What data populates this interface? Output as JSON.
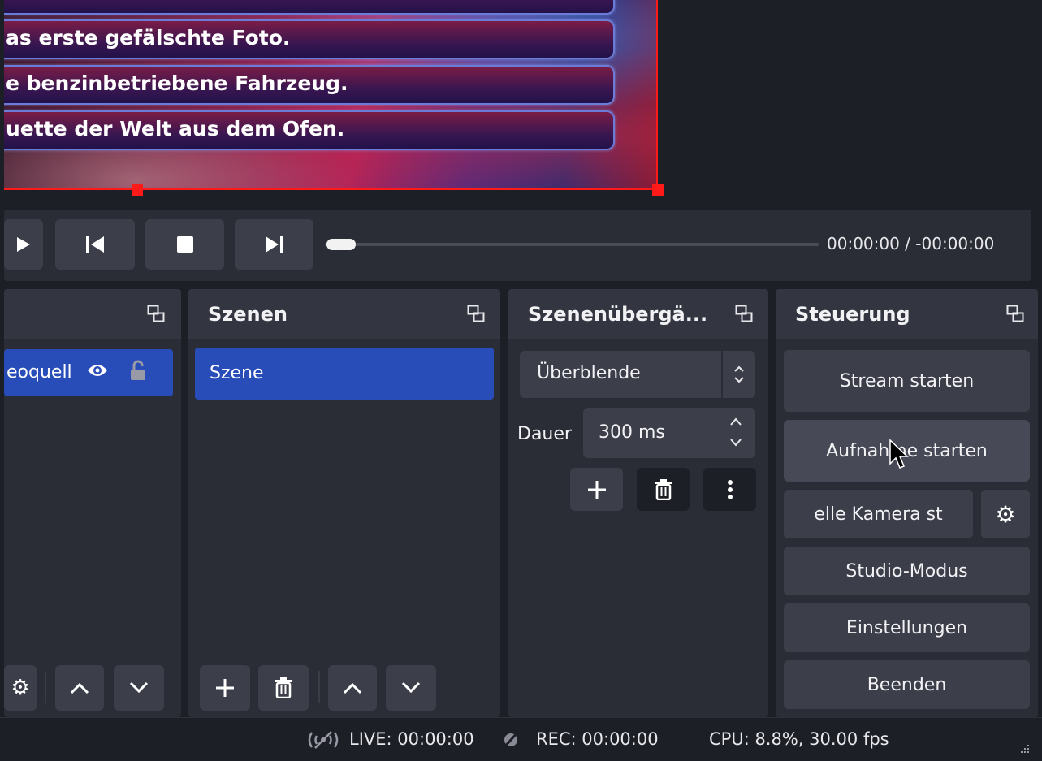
{
  "preview": {
    "answers": [
      "as erste gefälschte Foto.",
      "e benzinbetriebene Fahrzeug.",
      "uette der Welt aus dem Ofen."
    ]
  },
  "media": {
    "time": "00:00:00  /  -00:00:00",
    "seek_progress": 0.0
  },
  "sources": {
    "item_label": "eoquell"
  },
  "scenes": {
    "title": "Szenen",
    "items": [
      "Szene"
    ]
  },
  "transitions": {
    "title": "Szenenübergä...",
    "selected": "Überblende",
    "duration_label": "Dauer",
    "duration_value": "300 ms"
  },
  "controls": {
    "title": "Steuerung",
    "stream_button": "Stream starten",
    "record_button": "Aufnahme starten",
    "virtual_camera_button": "elle Kamera st",
    "studio_mode_button": "Studio-Modus",
    "settings_button": "Einstellungen",
    "exit_button": "Beenden"
  },
  "status": {
    "live": "LIVE: 00:00:00",
    "rec": "REC: 00:00:00",
    "cpu": "CPU: 8.8%, 30.00 fps"
  },
  "colors": {
    "accent_selection": "#284cb8",
    "preview_frame": "#ff1a1a",
    "panel": "#2a2d35",
    "button": "#3c3f4a"
  }
}
